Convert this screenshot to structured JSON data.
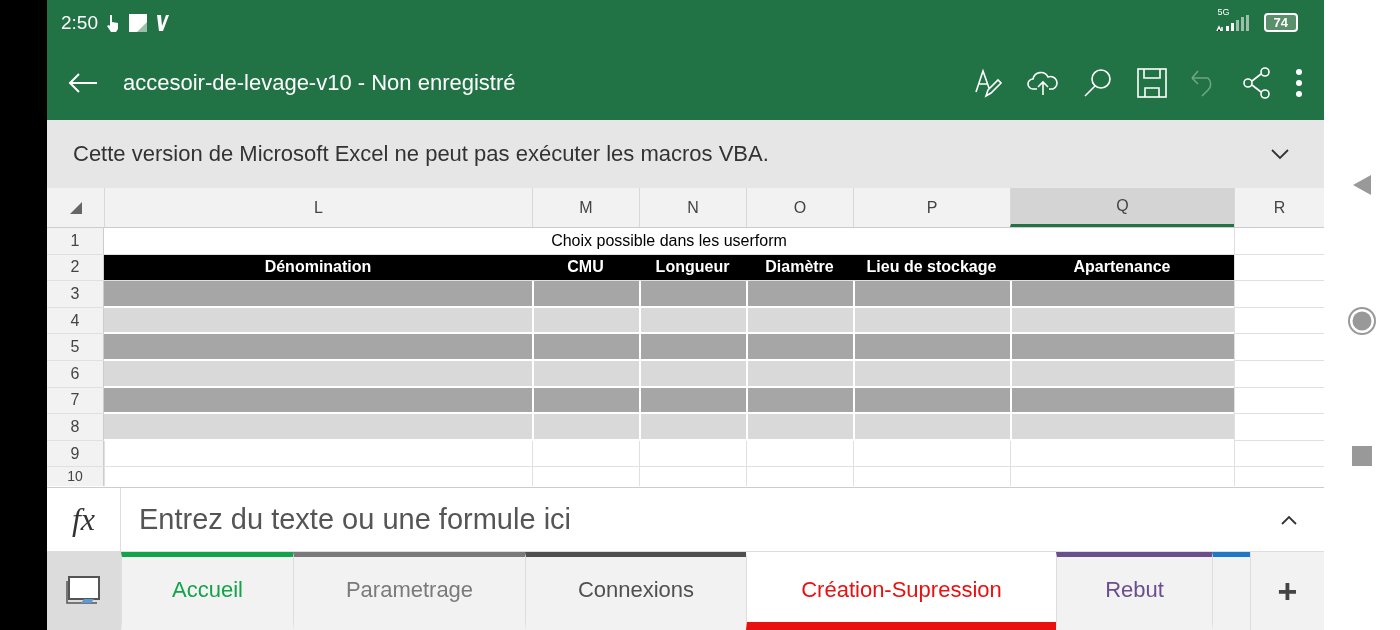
{
  "status_bar": {
    "time": "2:50",
    "network": "5G",
    "battery": "74"
  },
  "title_bar": {
    "title": "accesoir-de-levage-v10 - Non enregistré"
  },
  "banner": {
    "message": "Cette version de Microsoft Excel ne peut pas exécuter les macros VBA."
  },
  "sheet": {
    "columns": [
      {
        "label": "L",
        "selected": false
      },
      {
        "label": "M",
        "selected": false
      },
      {
        "label": "N",
        "selected": false
      },
      {
        "label": "O",
        "selected": false
      },
      {
        "label": "P",
        "selected": false
      },
      {
        "label": "Q",
        "selected": true
      },
      {
        "label": "R",
        "selected": false
      }
    ],
    "rows": [
      {
        "number": "1",
        "kind": "title",
        "text": "Choix possible dans les userform"
      },
      {
        "number": "2",
        "kind": "header",
        "cells": [
          "Dénomination",
          "CMU",
          "Longueur",
          "Diamètre",
          "Lieu de stockage",
          "Apartenance"
        ]
      },
      {
        "number": "3",
        "kind": "band",
        "color": "#a6a6a6"
      },
      {
        "number": "4",
        "kind": "band",
        "color": "#d9d9d9"
      },
      {
        "number": "5",
        "kind": "band",
        "color": "#a6a6a6"
      },
      {
        "number": "6",
        "kind": "band",
        "color": "#d9d9d9"
      },
      {
        "number": "7",
        "kind": "band",
        "color": "#a6a6a6"
      },
      {
        "number": "8",
        "kind": "band",
        "color": "#d9d9d9"
      },
      {
        "number": "9",
        "kind": "blank"
      },
      {
        "number": "10",
        "kind": "blank"
      }
    ]
  },
  "formula_bar": {
    "label": "fx",
    "placeholder": "Entrez du texte ou une formule ici"
  },
  "sheet_tabs": [
    {
      "label": "Accueil",
      "color": "#13a34a",
      "selected": false
    },
    {
      "label": "Parametrage",
      "color": "#7a7a7a",
      "selected": false
    },
    {
      "label": "Connexions",
      "color": "#505050",
      "selected": false
    },
    {
      "label": "Création-Supression",
      "color": "#e81010",
      "selected": true
    },
    {
      "label": "Rebut",
      "color": "#6a4f8c",
      "selected": false
    },
    {
      "color": "#1f77c8",
      "selected": false
    }
  ],
  "add_sheet": "+"
}
